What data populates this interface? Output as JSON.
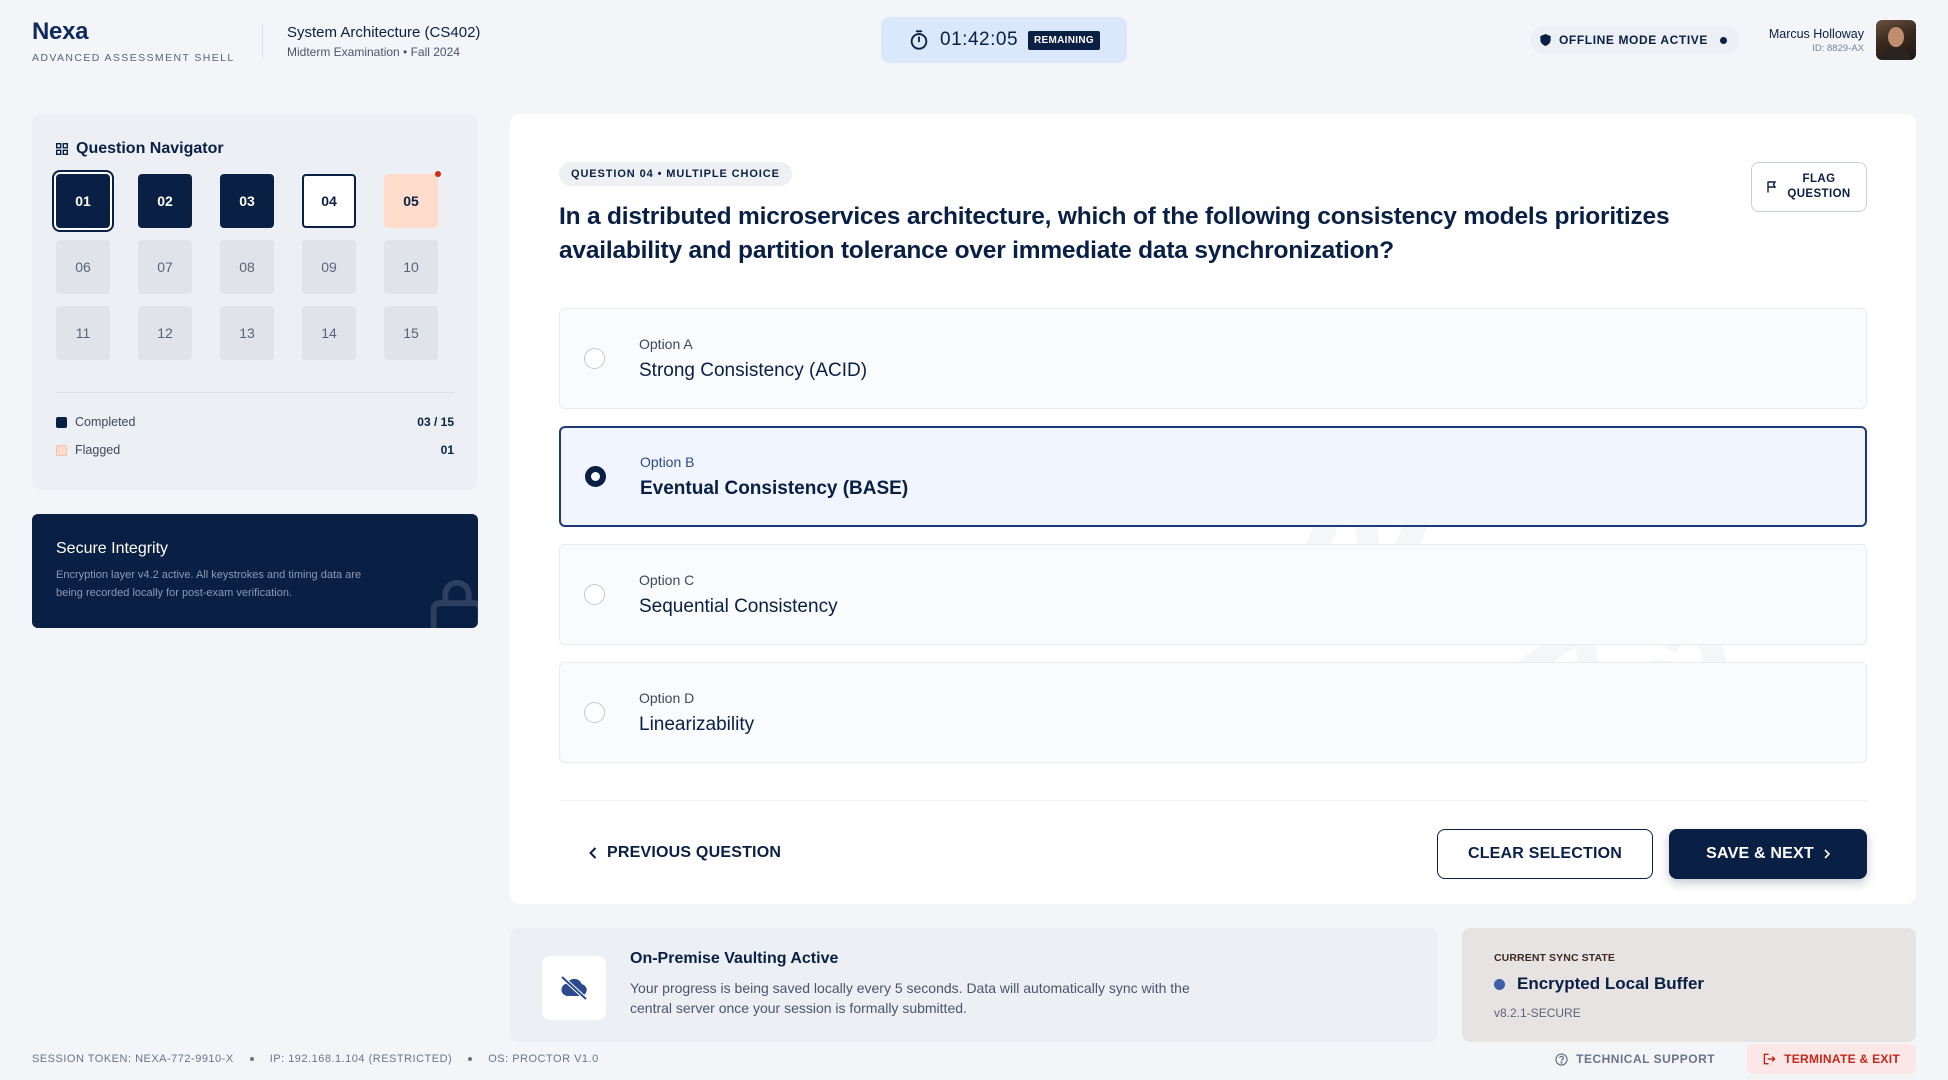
{
  "colors": {
    "primary": "#0a1f44",
    "accent": "#1e3a7a",
    "flagged": "#ffdccc",
    "danger": "#c4261a",
    "timer_bg": "#dbe7fb"
  },
  "header": {
    "brand": "Nexa",
    "brand_sub": "ADVANCED ASSESSMENT SHELL",
    "course_title": "System Architecture (CS402)",
    "course_sub": "Midterm Examination • Fall 2024",
    "timer": {
      "icon": "stopwatch-icon",
      "value": "01:42:05",
      "badge": "REMAINING"
    },
    "offline": {
      "icon": "shield-icon",
      "label": "OFFLINE MODE ACTIVE"
    },
    "user": {
      "name": "Marcus Holloway",
      "id": "ID: 8829-AX"
    }
  },
  "navigator": {
    "title": "Question Navigator",
    "icon": "grid-icon",
    "questions": [
      {
        "label": "01",
        "state": "current-done"
      },
      {
        "label": "02",
        "state": "done"
      },
      {
        "label": "03",
        "state": "done"
      },
      {
        "label": "04",
        "state": "current"
      },
      {
        "label": "05",
        "state": "flagged"
      },
      {
        "label": "06",
        "state": "todo"
      },
      {
        "label": "07",
        "state": "todo"
      },
      {
        "label": "08",
        "state": "todo"
      },
      {
        "label": "09",
        "state": "todo"
      },
      {
        "label": "10",
        "state": "todo"
      },
      {
        "label": "11",
        "state": "todo"
      },
      {
        "label": "12",
        "state": "todo"
      },
      {
        "label": "13",
        "state": "todo"
      },
      {
        "label": "14",
        "state": "todo"
      },
      {
        "label": "15",
        "state": "todo"
      }
    ],
    "legend": {
      "completed_label": "Completed",
      "completed_value": "03 / 15",
      "flagged_label": "Flagged",
      "flagged_value": "01"
    }
  },
  "integrity": {
    "title": "Secure Integrity",
    "text": "Encryption layer v4.2 active. All keystrokes and timing data are being recorded locally for post-exam verification."
  },
  "question": {
    "tag": "QUESTION 04 • MULTIPLE CHOICE",
    "text": "In a distributed microservices architecture, which of the following consistency models prioritizes availability and partition tolerance over immediate data synchronization?",
    "flag_label_1": "FLAG",
    "flag_label_2": "QUESTION",
    "options": [
      {
        "label": "Option A",
        "text": "Strong Consistency (ACID)",
        "selected": false
      },
      {
        "label": "Option B",
        "text": "Eventual Consistency (BASE)",
        "selected": true
      },
      {
        "label": "Option C",
        "text": "Sequential Consistency",
        "selected": false
      },
      {
        "label": "Option D",
        "text": "Linearizability",
        "selected": false
      }
    ],
    "prev_label": "PREVIOUS QUESTION",
    "clear_label": "CLEAR SELECTION",
    "next_label": "SAVE & NEXT"
  },
  "vault": {
    "title": "On-Premise Vaulting Active",
    "text": "Your progress is being saved locally every 5 seconds. Data will automatically sync with the central server once your session is formally submitted.",
    "icon": "cloud-off-icon"
  },
  "sync": {
    "label": "CURRENT SYNC STATE",
    "state": "Encrypted Local Buffer",
    "version": "v8.2.1-SECURE"
  },
  "footer": {
    "token": "SESSION TOKEN: NEXA-772-9910-X",
    "ip": "IP: 192.168.1.104 (RESTRICTED)",
    "os": "OS: PROCTOR V1.0",
    "support": "TECHNICAL SUPPORT",
    "terminate": "TERMINATE & EXIT"
  }
}
